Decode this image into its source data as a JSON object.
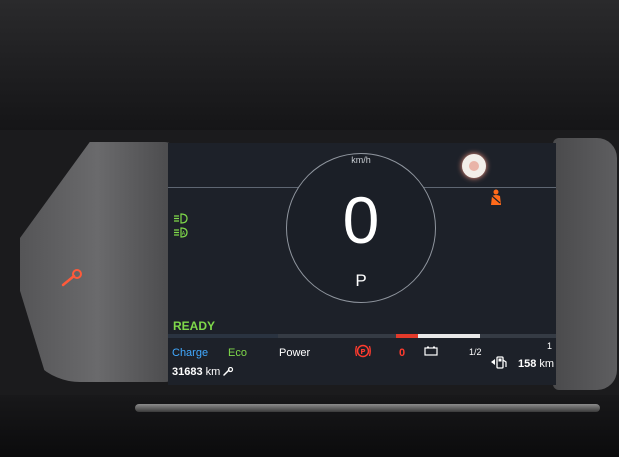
{
  "speedometer": {
    "value": "0",
    "unit": "km/h",
    "gear": "P"
  },
  "status": {
    "ready": "READY"
  },
  "modes": {
    "charge": "Charge",
    "eco": "Eco",
    "power": "Power"
  },
  "indicators": {
    "parking_brake_count": "0",
    "fuel_level": "1/2",
    "fuel_max": "1"
  },
  "trip": {
    "odometer": "31683",
    "odometer_unit": "km",
    "range": "158",
    "range_unit": "km"
  },
  "colors": {
    "ready_green": "#7fd94a",
    "charge_blue": "#41a9ff",
    "eco_green": "#7fd94a",
    "warning_red": "#ff3b2e",
    "warning_orange": "#ff6a1a"
  },
  "icons": [
    "low-beam-icon",
    "auto-headlight-icon",
    "seatbelt-warning-icon",
    "parking-brake-icon",
    "battery-icon",
    "fuel-pump-icon",
    "service-wrench-icon",
    "warning-light-icon"
  ]
}
